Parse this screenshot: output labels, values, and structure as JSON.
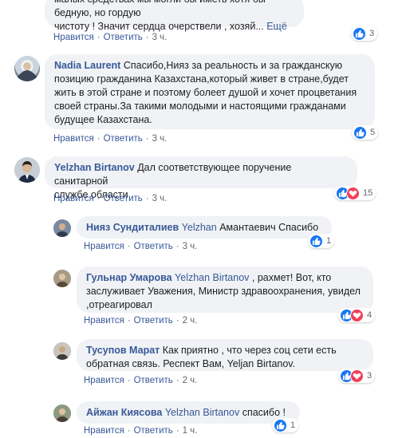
{
  "comments": [
    {
      "line1": "малых средствах мы могли бы иметь хотя бы бедную, но гордую",
      "line2": "чистоту ! Значит сердца очерствели , хозяй...",
      "more": "Ещё",
      "like": "Нравится",
      "reply": "Ответить",
      "time": "3 ч.",
      "reactions": "3"
    },
    {
      "author": "Nadia Laurent",
      "text_first": "Спасибо,Нияз за реальность и за гражданскую",
      "lines": [
        "позицию гражданина Казахстана,который живет в стране,будет",
        "жить в этой стране и поэтому болеет душой и хочет процветания",
        "своей страны.За такими молодыми и настоящими гражданами",
        "будущее Казахстана."
      ],
      "like": "Нравится",
      "reply": "Ответить",
      "time": "3 ч.",
      "reactions": "5"
    },
    {
      "author": "Yelzhan Birtanov",
      "text_first": "Дал соответствующее поручение санитарной",
      "lines": [
        "службе области"
      ],
      "like": "Нравится",
      "reply": "Ответить",
      "time": "3 ч.",
      "reactions": "15"
    }
  ],
  "replies": [
    {
      "author": "Нияз Сундиталиев",
      "mention": "Yelzhan",
      "text": "Амантаевич Спасибо",
      "like": "Нравится",
      "reply": "Ответить",
      "time": "3 ч.",
      "reactions": "1"
    },
    {
      "author": "Гульнар Умарова",
      "mention": "Yelzhan Birtanov",
      "text": ", рахмет! Вот, кто",
      "lines": [
        "заслуживает Уважения, Министр здравоохранения, увидел",
        ",отреагировал"
      ],
      "like": "Нравится",
      "reply": "Ответить",
      "time": "2 ч.",
      "reactions": "4"
    },
    {
      "author": "Тусупов Марат",
      "text": "Как приятно , что через соц сети есть",
      "lines": [
        "обратная связь. Респект Вам, Yeljan Birtanov."
      ],
      "like": "Нравится",
      "reply": "Ответить",
      "time": "2 ч.",
      "reactions": "3"
    },
    {
      "author": "Айжан Киясова",
      "mention": "Yelzhan Birtanov",
      "text": "спасибо !",
      "like": "Нравится",
      "reply": "Ответить",
      "time": "1 ч.",
      "reactions": "1"
    }
  ],
  "colors": {
    "link": "#385898",
    "bubble": "#f0f2f5",
    "like": "#1877f2",
    "love": "#f33e58"
  }
}
